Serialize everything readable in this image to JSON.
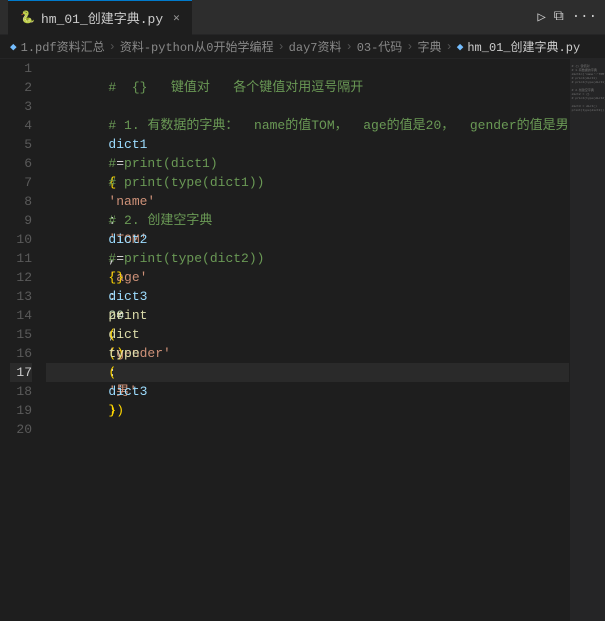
{
  "titlebar": {
    "tab_label": "hm_01_创建字典.py",
    "tab_icon": "🐍",
    "close_label": "✕",
    "action_run": "▷",
    "action_split": "⧉",
    "action_more": "···"
  },
  "breadcrumb": {
    "items": [
      "1.pdf资料汇总",
      "资料-python从0开始学编程",
      "day7资料",
      "03-代码",
      "字典",
      "hm_01_创建字典.py"
    ]
  },
  "lines": [
    {
      "num": 1,
      "active": false
    },
    {
      "num": 2,
      "active": false
    },
    {
      "num": 3,
      "active": false
    },
    {
      "num": 4,
      "active": false
    },
    {
      "num": 5,
      "active": false
    },
    {
      "num": 6,
      "active": false
    },
    {
      "num": 7,
      "active": false
    },
    {
      "num": 8,
      "active": false
    },
    {
      "num": 9,
      "active": false
    },
    {
      "num": 10,
      "active": false
    },
    {
      "num": 11,
      "active": false
    },
    {
      "num": 12,
      "active": false
    },
    {
      "num": 13,
      "active": false
    },
    {
      "num": 14,
      "active": false
    },
    {
      "num": 15,
      "active": false
    },
    {
      "num": 16,
      "active": false
    },
    {
      "num": 17,
      "active": true
    },
    {
      "num": 18,
      "active": false
    },
    {
      "num": 19,
      "active": false
    },
    {
      "num": 20,
      "active": false
    }
  ]
}
